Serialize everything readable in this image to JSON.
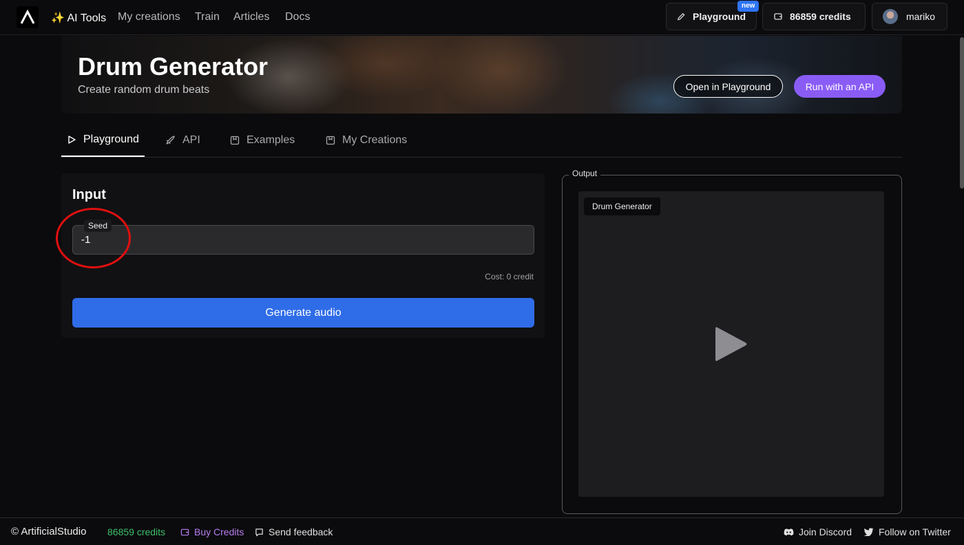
{
  "nav": {
    "links": [
      "✨ AI Tools",
      "My creations",
      "Train",
      "Articles",
      "Docs"
    ],
    "playground_label": "Playground",
    "new_badge": "new",
    "credits_label": "86859 credits",
    "user_name": "mariko"
  },
  "hero": {
    "title": "Drum Generator",
    "subtitle": "Create random drum beats",
    "open_playground": "Open in Playground",
    "run_api": "Run with an API"
  },
  "tabs": [
    "Playground",
    "API",
    "Examples",
    "My Creations"
  ],
  "input": {
    "title": "Input",
    "seed_label": "Seed",
    "seed_value": "-1",
    "cost": "Cost: 0 credit",
    "generate": "Generate audio"
  },
  "output": {
    "label": "Output",
    "chip": "Drum Generator"
  },
  "footer": {
    "brand": "© ArtificialStudio",
    "credits": "86859 credits",
    "buy": "Buy Credits",
    "feedback": "Send feedback",
    "discord": "Join Discord",
    "twitter": "Follow on Twitter"
  },
  "colors": {
    "accent_blue": "#2f6ce8",
    "accent_purple": "#8a5cf6",
    "credits_green": "#3fbf6a",
    "annotation_red": "#e10f0f"
  }
}
